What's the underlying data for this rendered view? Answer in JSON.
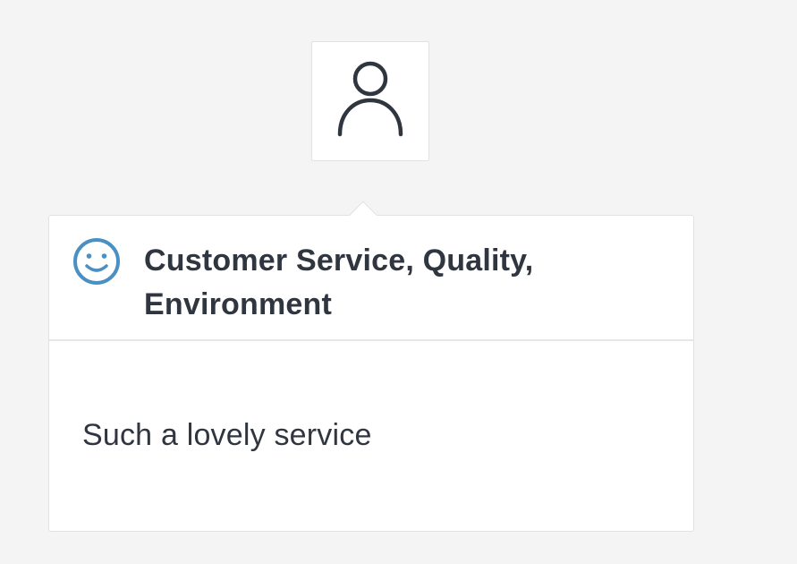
{
  "avatar": {
    "icon": "user-icon"
  },
  "feedback": {
    "sentiment_icon": "smiley-face-icon",
    "sentiment_color": "#4a90c2",
    "categories_title": "Customer Service, Quality, Environment",
    "comment": "Such a lovely service"
  }
}
